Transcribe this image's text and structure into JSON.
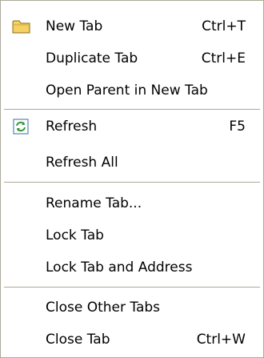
{
  "menu": {
    "items": [
      {
        "label": "New Tab",
        "shortcut": "Ctrl+T",
        "icon": "folder-icon"
      },
      {
        "label": "Duplicate Tab",
        "shortcut": "Ctrl+E"
      },
      {
        "label": "Open Parent in New Tab"
      },
      {
        "label": "Refresh",
        "shortcut": "F5",
        "icon": "refresh-icon"
      },
      {
        "label": "Refresh All"
      },
      {
        "label": "Rename Tab..."
      },
      {
        "label": "Lock Tab"
      },
      {
        "label": "Lock Tab and Address"
      },
      {
        "label": "Close Other Tabs"
      },
      {
        "label": "Close Tab",
        "shortcut": "Ctrl+W"
      }
    ]
  },
  "colors": {
    "separator": "#aca899",
    "folder": "#f5d062",
    "refresh": "#2e9a3a"
  }
}
